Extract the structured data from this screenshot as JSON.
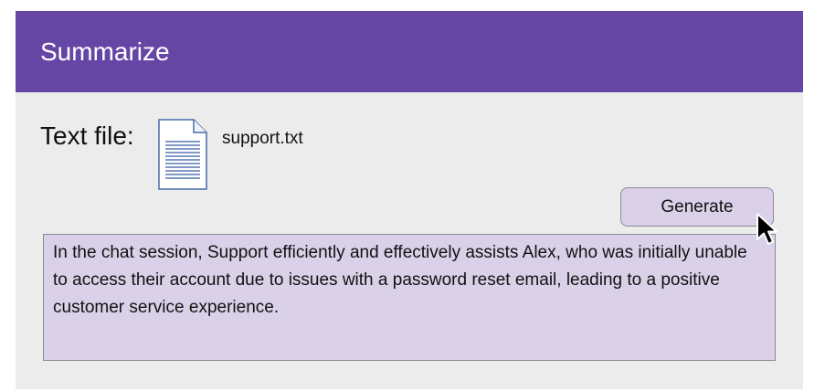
{
  "header": {
    "title": "Summarize"
  },
  "file": {
    "label": "Text file:",
    "icon": "text-document-icon",
    "name": "support.txt"
  },
  "generate": {
    "label": "Generate"
  },
  "summary": {
    "text": "In the chat session, Support efficiently and effectively assists Alex, who was initially unable to access their account due to issues with a password reset email, leading to a positive customer service experience."
  },
  "colors": {
    "header": "#6646a4",
    "panel": "#ececec",
    "accent_fill": "#dad0e8"
  }
}
